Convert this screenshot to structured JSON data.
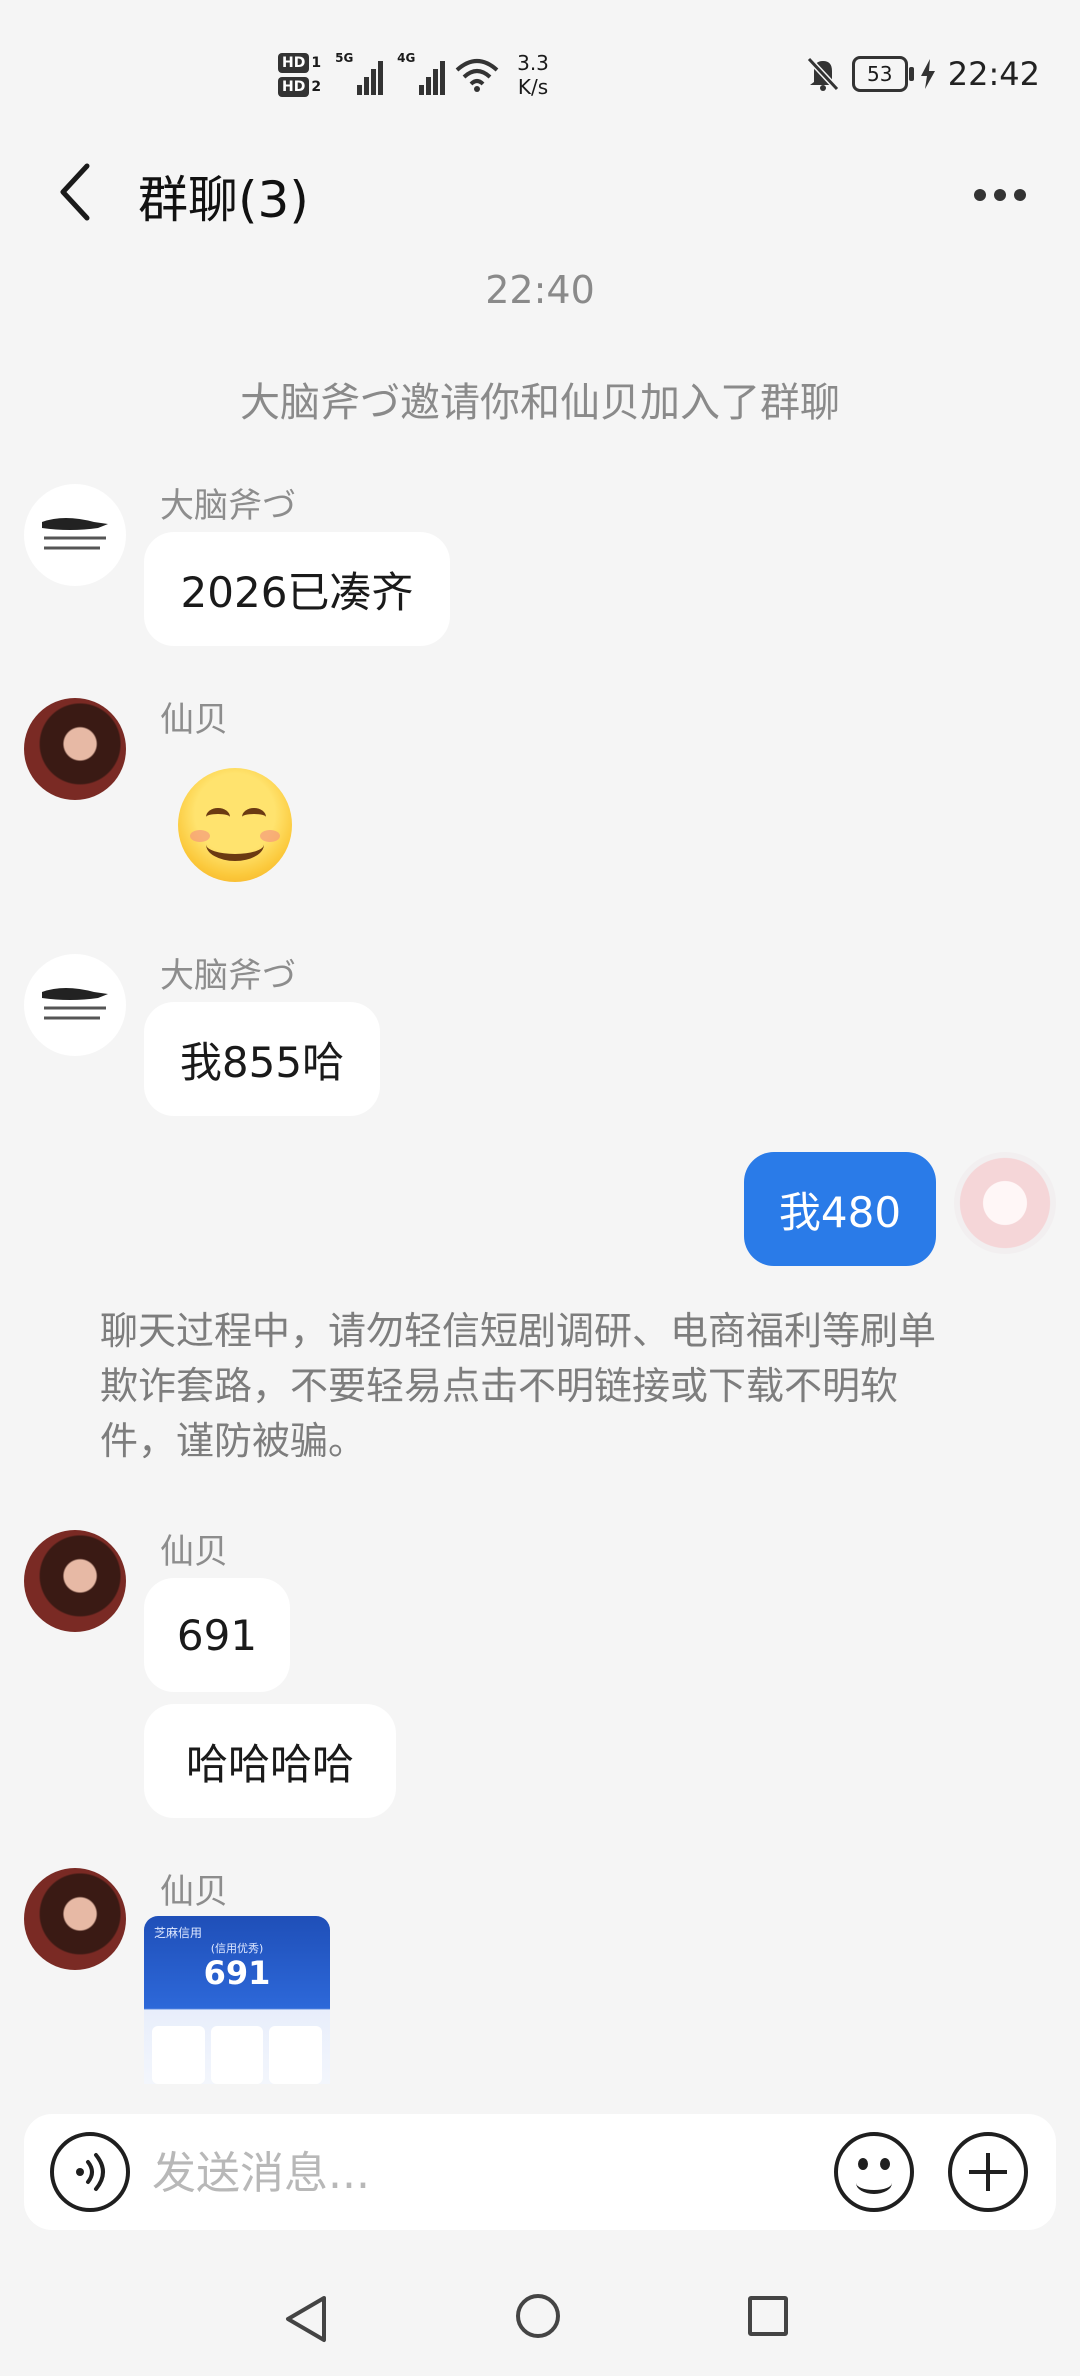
{
  "status_bar": {
    "hd1": "HD",
    "hd1_n": "1",
    "hd2": "HD",
    "hd2_n": "2",
    "net1": "5G",
    "net2": "4G",
    "speed_value": "3.3",
    "speed_unit": "K/s",
    "battery": "53",
    "time": "22:42",
    "icons": [
      "signal-icon",
      "wifi-icon",
      "bell-muted-icon",
      "charging-icon"
    ]
  },
  "header": {
    "title": "群聊(3)",
    "back_icon": "chevron-left-icon",
    "more_icon": "more-icon"
  },
  "chat": {
    "timestamp": "22:40",
    "system_message": "大脑斧づ邀请你和仙贝加入了群聊",
    "messages": [
      {
        "sender": "大脑斧づ",
        "text": "2026已凑齐"
      },
      {
        "sender": "仙贝",
        "type": "emoji",
        "emoji": "smiling-face"
      },
      {
        "sender": "大脑斧づ",
        "text": "我855哈"
      },
      {
        "sender": "me",
        "text": "我480"
      },
      {
        "sender": "仙贝",
        "text": "691"
      },
      {
        "sender": "仙贝",
        "text": "哈哈哈哈"
      },
      {
        "sender": "仙贝",
        "type": "image",
        "image_texts": [
          "芝麻信用",
          "(信用优秀)",
          "691"
        ]
      }
    ],
    "warning": "聊天过程中，请勿轻信短剧调研、电商福利等刷单欺诈套路，不要轻易点击不明链接或下载不明软件，谨防被骗。"
  },
  "input": {
    "placeholder": "发送消息..."
  },
  "colors": {
    "background": "#f5f5f5",
    "my_bubble": "#2a7be8",
    "other_bubble": "#ffffff",
    "meta_text": "#8a8a8a"
  }
}
